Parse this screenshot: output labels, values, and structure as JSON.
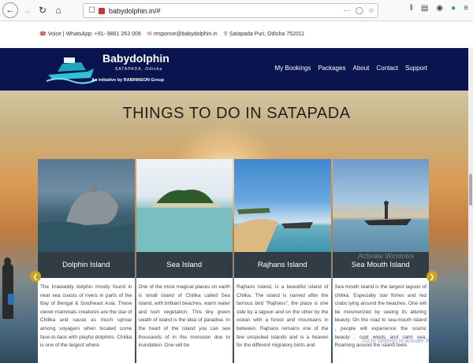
{
  "browser": {
    "url": "babydolphin.in/#",
    "icons": [
      "back-icon",
      "forward-icon",
      "reload-icon",
      "home-icon",
      "shield-icon",
      "lock-icon",
      "more-icon",
      "pocket-icon",
      "star-icon",
      "library-icon",
      "reader-icon",
      "account-icon",
      "extension-icon",
      "menu-icon"
    ]
  },
  "contact": {
    "phone": "Voice | WhatsApp: +91- 9861 263 008",
    "email": "response@babydolphin.in",
    "address": "Satapada Puri, Odisha 752011"
  },
  "brand": {
    "name": "Babydolphin",
    "sub": "SATAPADA, Odisha",
    "tagline": "An initiative by RABINNSON Group"
  },
  "nav": [
    "My Bookings",
    "Packages",
    "About",
    "Contact",
    "Support"
  ],
  "hero": {
    "title": "THINGS TO DO IN SATAPADA",
    "watermark": "Activate Windows",
    "watermark2": "Go to Settings to activate Windows."
  },
  "cards": [
    {
      "title": "Dolphin Island",
      "text": "The Irrawaddy dolphin mostly found in near sea coasts of rivers in parts of the Bay of Bengal & Southeast Asia. These clever mammals creatures are the star of Chilika and cause as much uproar among voyagers when located come face-to-face with playful dolphins. Chilika is one of the largest where"
    },
    {
      "title": "Sea Island",
      "text": "One of the most magical places on earth is small island of Chilika called Sea island, with brilliant beaches, warm water and lush vegetation. This tiny green swath of island is the idea of paradise. In the heart of the island you can see thousands of in the monsoon due to inundation. One will be"
    },
    {
      "title": "Rajhans Island",
      "text": "Rajhans Island, is a beautiful island of Chilka. The island is named after the famous bird \"Rajhans\", the place is one side by a lagoon and on the other by the ocean with a forest and mountains in between. Rajhans remains one of the few unspoiled islands and is a heaven for the different migratory birds and"
    },
    {
      "title": "Sea Mouth Island",
      "text": "Sea mouth island is the largest lagoon of chilika. Especially star fishes and red crabs lying around the beaches. One will be mesmerized by seeing its alluring beauty. On the road to sea-mouth island , people will experience the scenic beauty , cool winds and calm sea. Roaming around the island feels"
    }
  ]
}
